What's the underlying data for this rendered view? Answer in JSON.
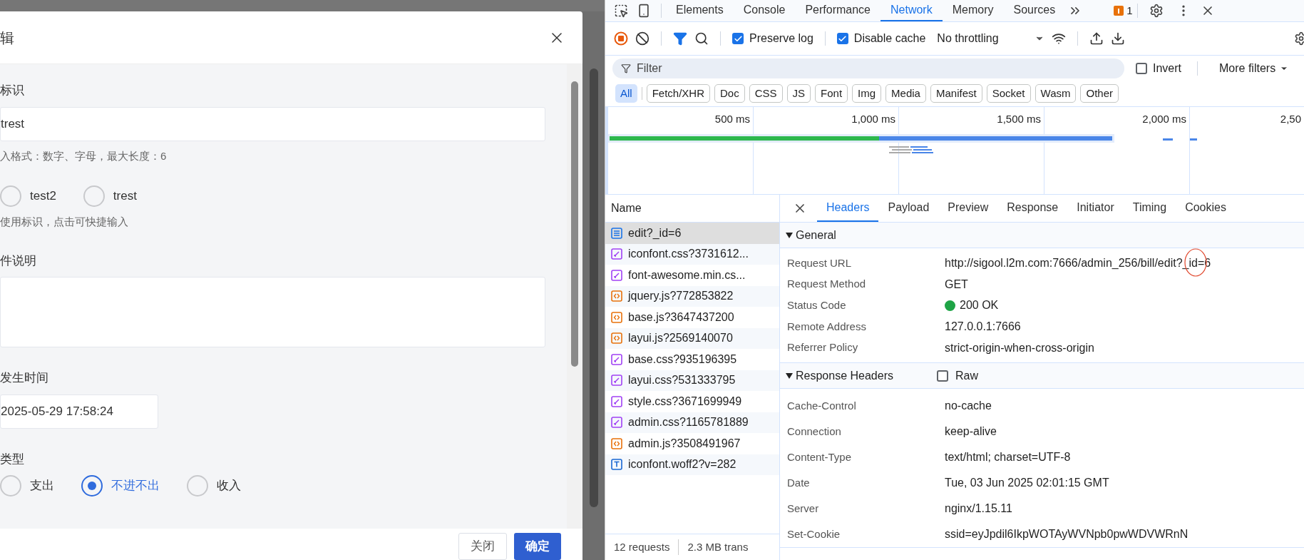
{
  "dialog": {
    "title": "辑",
    "fields": [
      {
        "kind": "text",
        "label": "标识",
        "value": "trest",
        "hint": "入格式：数字、字母，最大长度：6"
      },
      {
        "kind": "radios",
        "options": [
          {
            "label": "test2",
            "selected": false
          },
          {
            "label": "trest",
            "selected": false
          }
        ],
        "hint": "使用标识，点击可快捷输入"
      },
      {
        "kind": "textarea",
        "label": "件说明"
      },
      {
        "kind": "date",
        "label": "发生时间",
        "value": "2025-05-29 17:58:24"
      },
      {
        "kind": "radios",
        "label": "类型",
        "options": [
          {
            "label": "支出",
            "selected": false
          },
          {
            "label": "不进不出",
            "selected": true
          },
          {
            "label": "收入",
            "selected": false
          }
        ]
      }
    ],
    "buttons": [
      {
        "label": "关闭",
        "primary": false
      },
      {
        "label": "确定",
        "primary": true
      }
    ]
  },
  "devtools": {
    "tabs": [
      {
        "label": "Elements",
        "selected": false
      },
      {
        "label": "Console",
        "selected": false
      },
      {
        "label": "Performance",
        "selected": false
      },
      {
        "label": "Network",
        "selected": true
      },
      {
        "label": "Memory",
        "selected": false
      },
      {
        "label": "Sources",
        "selected": false
      }
    ],
    "issues_count": "1",
    "toolbar": {
      "preserve_log": {
        "label": "Preserve log",
        "checked": true
      },
      "disable_cache": {
        "label": "Disable cache",
        "checked": true
      },
      "throttling": "No throttling"
    },
    "filter": {
      "placeholder": "Filter",
      "invert": {
        "label": "Invert",
        "checked": false
      },
      "more_filters": "More filters"
    },
    "type_filters": [
      {
        "label": "All",
        "selected": true
      },
      {
        "label": "Fetch/XHR",
        "selected": false
      },
      {
        "label": "Doc",
        "selected": false
      },
      {
        "label": "CSS",
        "selected": false
      },
      {
        "label": "JS",
        "selected": false
      },
      {
        "label": "Font",
        "selected": false
      },
      {
        "label": "Img",
        "selected": false
      },
      {
        "label": "Media",
        "selected": false
      },
      {
        "label": "Manifest",
        "selected": false
      },
      {
        "label": "Socket",
        "selected": false
      },
      {
        "label": "Wasm",
        "selected": false
      },
      {
        "label": "Other",
        "selected": false
      }
    ],
    "timeline_ticks": [
      "500 ms",
      "1,000 ms",
      "1,500 ms",
      "2,000 ms",
      "2,50"
    ],
    "requests": {
      "column": "Name",
      "rows": [
        {
          "kind": "doc",
          "name": "edit?_id=6",
          "selected": true
        },
        {
          "kind": "css",
          "name": "iconfont.css?3731612...",
          "selected": false
        },
        {
          "kind": "css",
          "name": "font-awesome.min.cs...",
          "selected": false
        },
        {
          "kind": "js",
          "name": "jquery.js?772853822",
          "selected": false
        },
        {
          "kind": "js",
          "name": "base.js?3647437200",
          "selected": false
        },
        {
          "kind": "js",
          "name": "layui.js?2569140070",
          "selected": false
        },
        {
          "kind": "css",
          "name": "base.css?935196395",
          "selected": false
        },
        {
          "kind": "css",
          "name": "layui.css?531333795",
          "selected": false
        },
        {
          "kind": "css",
          "name": "style.css?3671699949",
          "selected": false
        },
        {
          "kind": "css",
          "name": "admin.css?1165781889",
          "selected": false
        },
        {
          "kind": "js",
          "name": "admin.js?3508491967",
          "selected": false
        },
        {
          "kind": "font",
          "name": "iconfont.woff2?v=282",
          "selected": false
        }
      ]
    },
    "status_bar": [
      "12 requests",
      "2.3 MB trans"
    ],
    "detail_tabs": [
      {
        "label": "Headers",
        "selected": true
      },
      {
        "label": "Payload",
        "selected": false
      },
      {
        "label": "Preview",
        "selected": false
      },
      {
        "label": "Response",
        "selected": false
      },
      {
        "label": "Initiator",
        "selected": false
      },
      {
        "label": "Timing",
        "selected": false
      },
      {
        "label": "Cookies",
        "selected": false
      }
    ],
    "general": {
      "title": "General",
      "rows": [
        {
          "name": "Request URL",
          "value": "http://sigool.l2m.com:7666/admin_256/bill/edit?_id=6"
        },
        {
          "name": "Request Method",
          "value": "GET"
        },
        {
          "name": "Status Code",
          "value": "200 OK",
          "color": "#1ea446"
        },
        {
          "name": "Remote Address",
          "value": "127.0.0.1:7666"
        },
        {
          "name": "Referrer Policy",
          "value": "strict-origin-when-cross-origin"
        }
      ]
    },
    "response_headers": {
      "title": "Response Headers",
      "raw": {
        "label": "Raw",
        "checked": false
      },
      "rows": [
        {
          "name": "Cache-Control",
          "value": "no-cache"
        },
        {
          "name": "Connection",
          "value": "keep-alive"
        },
        {
          "name": "Content-Type",
          "value": "text/html; charset=UTF-8"
        },
        {
          "name": "Date",
          "value": "Tue, 03 Jun 2025 02:01:15 GMT"
        },
        {
          "name": "Server",
          "value": "nginx/1.15.11"
        },
        {
          "name": "Set-Cookie",
          "value": "ssid=eyJpdil6IkpWOTAyWVNpb0pwWDVWRnN"
        }
      ]
    }
  }
}
